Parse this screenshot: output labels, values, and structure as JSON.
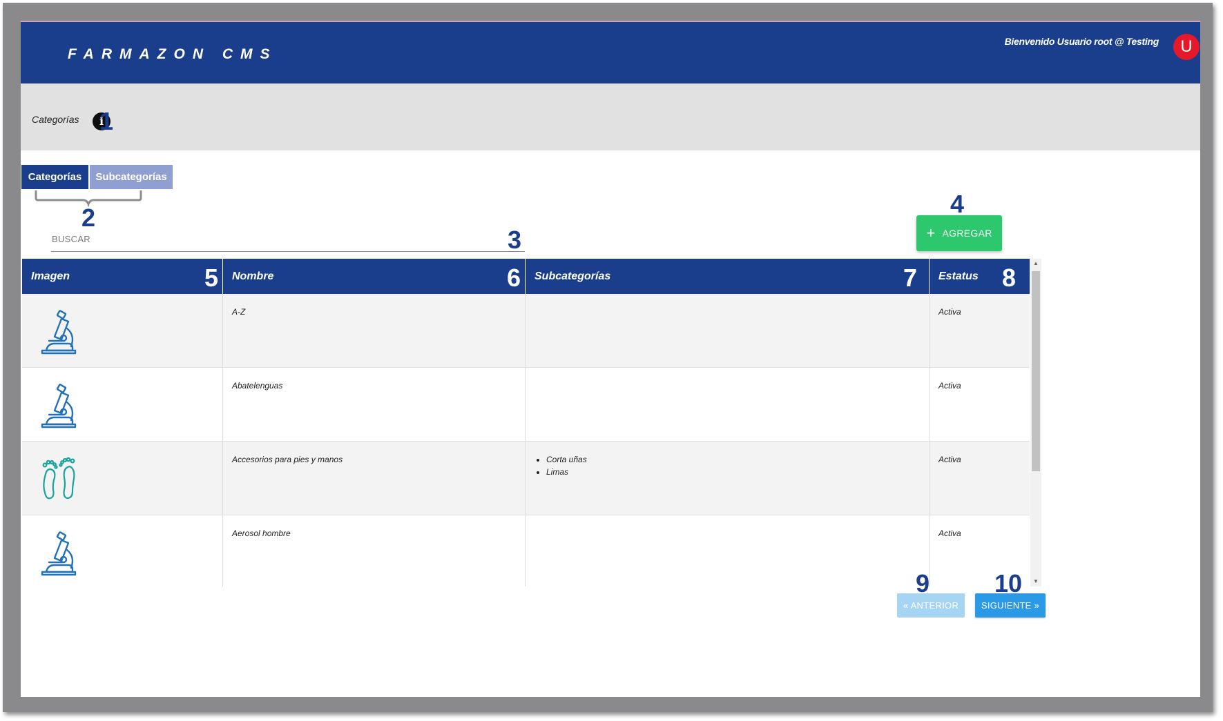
{
  "header": {
    "brand": "FARMAZON CMS",
    "welcome": "Bienvenido Usuario root @ Testing",
    "avatar_letter": "U"
  },
  "title_bar": {
    "title": "Categorías",
    "info_icon": "i"
  },
  "tabs": [
    {
      "label": "Categorías",
      "active": true
    },
    {
      "label": "Subcategorías",
      "active": false
    }
  ],
  "search": {
    "label": "BUSCAR"
  },
  "toolbar": {
    "add_label": "AGREGAR",
    "add_icon": "+"
  },
  "table": {
    "headers": [
      "Imagen",
      "Nombre",
      "Subcategorías",
      "Estatus"
    ],
    "rows": [
      {
        "icon": "microscope-icon",
        "name": "A-Z",
        "subcategories": [],
        "status": "Activa"
      },
      {
        "icon": "microscope-icon",
        "name": "Abatelenguas",
        "subcategories": [],
        "status": "Activa"
      },
      {
        "icon": "feet-icon",
        "name": "Accesorios para pies y manos",
        "subcategories": [
          "Corta uñas",
          "Limas"
        ],
        "status": "Activa"
      },
      {
        "icon": "microscope-icon",
        "name": "Aerosol hombre",
        "subcategories": [],
        "status": "Activa"
      }
    ]
  },
  "pagination": {
    "prev_label": "« ANTERIOR",
    "next_label": "SIGUIENTE »"
  },
  "callouts": [
    "1",
    "2",
    "3",
    "4",
    "5",
    "6",
    "7",
    "8",
    "9",
    "10"
  ],
  "colors": {
    "primary": "#1a3e8c",
    "tab_inactive": "#8f9fd2",
    "add": "#2dc86d",
    "next": "#2a9ae6",
    "prev_disabled": "#a6d5f4",
    "avatar": "#e5192a",
    "icon_blue": "#2270b8",
    "icon_teal": "#1aa39a"
  }
}
